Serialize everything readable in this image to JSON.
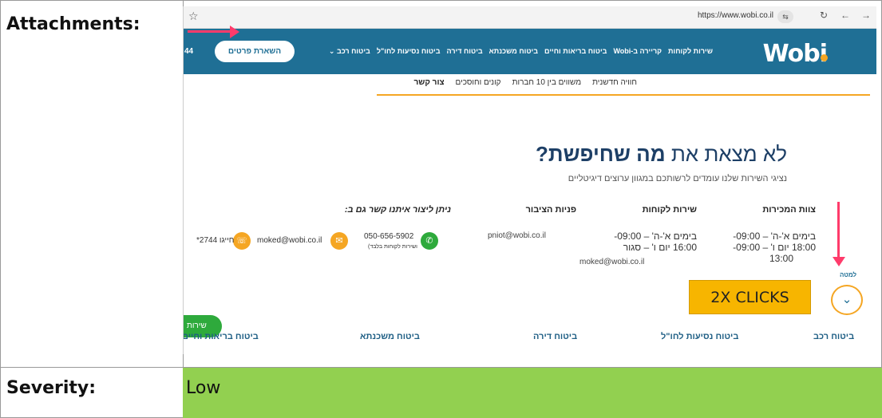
{
  "table": {
    "attachments_label": "Attachments:",
    "severity_label": "Severity:",
    "severity_value": "Low",
    "severity_color": "#92d050"
  },
  "browser": {
    "url": "https://www.wobi.co.il",
    "star_icon": "star-icon",
    "tab_icon": "tabs-icon",
    "reload_icon": "reload-icon",
    "back_icon": "back-icon",
    "forward_icon": "forward-icon"
  },
  "site": {
    "logo": "Wobi",
    "brand_color": "#1f6f95",
    "accent_color": "#f5a623",
    "nav_items": [
      "ביטוח רכב ⌄",
      "ביטוח נסיעות לחו\"ל",
      "ביטוח דירה",
      "ביטוח משכנתא",
      "ביטוח בריאות וחיים",
      "קריירה ב-Wobi",
      "שירות לקוחות"
    ],
    "leave_details_button": "השארת פרטים",
    "nav_number": "44",
    "subnav": [
      "צור קשר",
      "קונים וחוסכים",
      "משווים בין 10 חברות",
      "חוויה חדשנית"
    ],
    "headline_pre": "לא מצאת את ",
    "headline_bold": "מה שחיפשת?",
    "subheadline": "נציגי השירות שלנו עומדים לרשותכם במגוון ערוצים דיגיטליים",
    "columns": {
      "sales_title": "צוות המכירות",
      "sales_line1": "בימים א'-ה' – 09:00- ",
      "sales_line2": "18:00 יום ו' – 09:00-",
      "sales_line3": "13:00",
      "service_title": "שירות לקוחות",
      "service_line1": "בימים א'-ה' – 09:00-",
      "service_line2": "16:00 יום ו' – סגור",
      "service_email": "moked@wobi.co.il",
      "public_title": "פניות הציבור",
      "public_email": "pniot@wobi.co.il",
      "contact_title": "ניתן ליצור איתנו קשר גם ב:",
      "whatsapp_number": "050-656-5902",
      "whatsapp_sub": "ושירות לקוחות בלבד)",
      "email_contact": "moked@wobi.co.il",
      "phone_contact": "*2744 חייגו"
    },
    "down_label": "למטה",
    "down_icon": "chevron-down-icon",
    "clicks_annotation": "2X CLICKS",
    "service_pill": "שירות",
    "bottom_categories": [
      "ביטוח רכב",
      "ביטוח נסיעות לחו\"ל",
      "ביטוח דירה",
      "ביטוח משכנתא",
      "ביטוח בריאות וחיים"
    ]
  }
}
